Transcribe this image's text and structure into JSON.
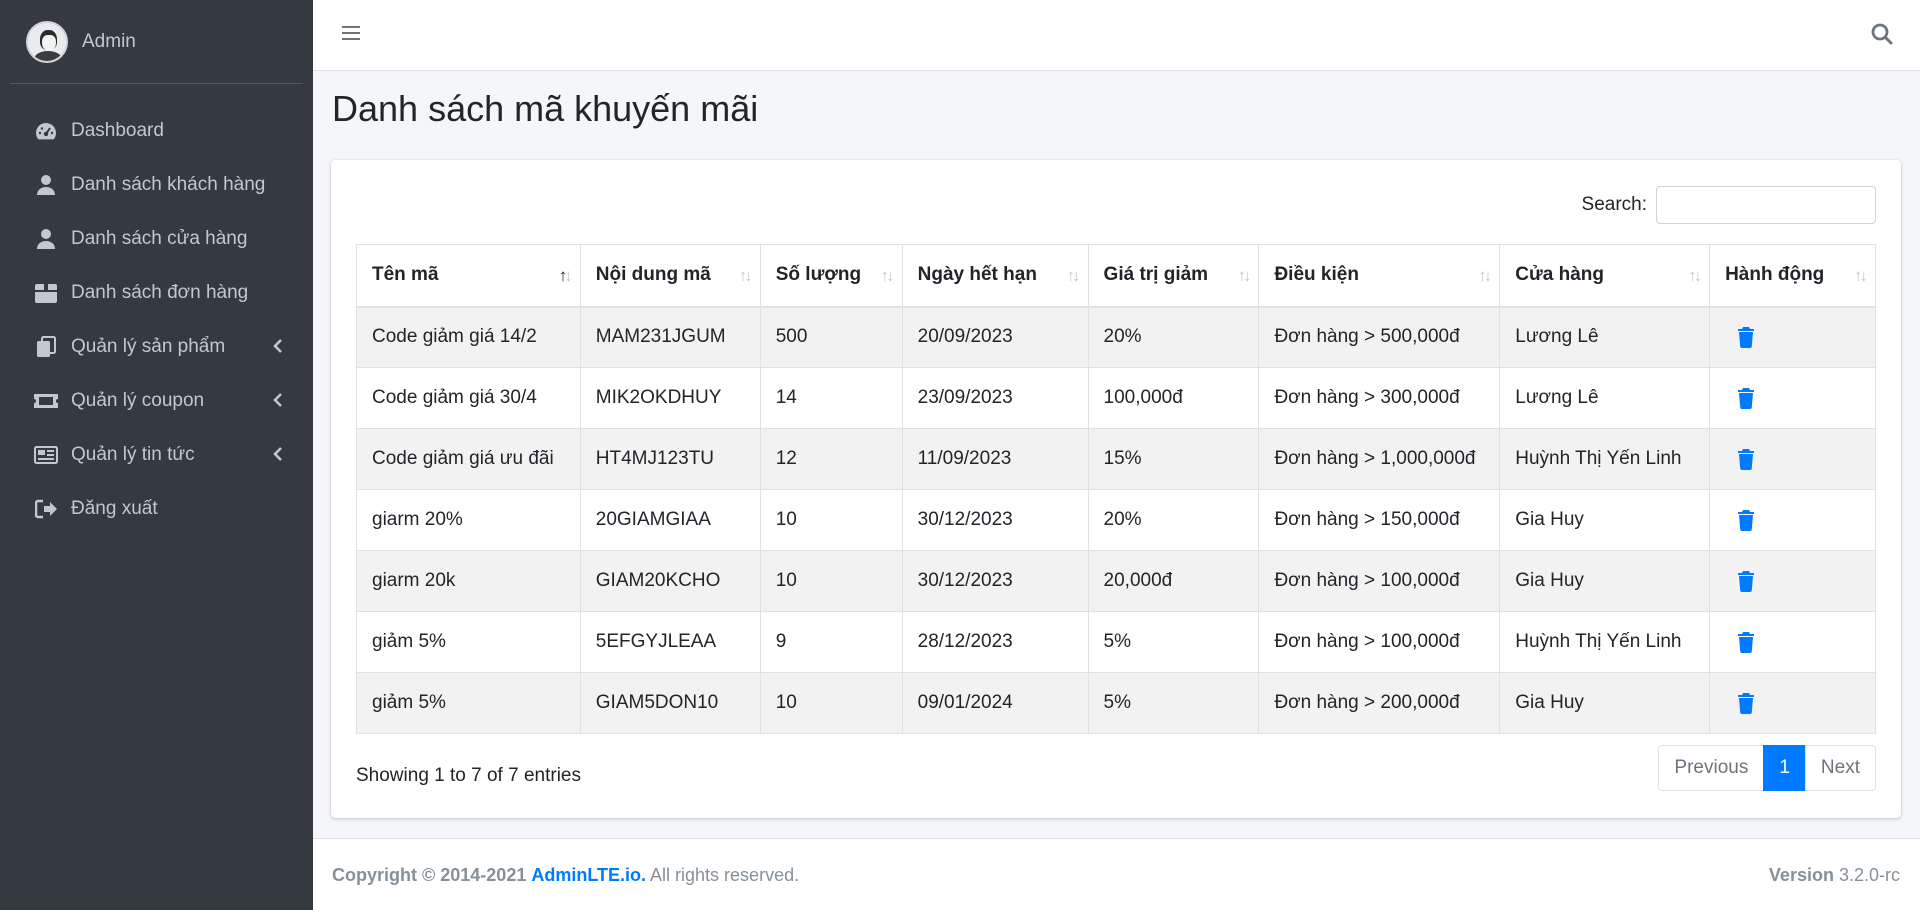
{
  "sidebar": {
    "user_name": "Admin",
    "items": [
      {
        "label": "Dashboard",
        "icon": "tachometer-icon"
      },
      {
        "label": "Danh sách khách hàng",
        "icon": "user-icon"
      },
      {
        "label": "Danh sách cửa hàng",
        "icon": "user-icon"
      },
      {
        "label": "Danh sách đơn hàng",
        "icon": "box-icon"
      },
      {
        "label": "Quản lý sản phẩm",
        "icon": "copy-icon",
        "expandable": true
      },
      {
        "label": "Quản lý coupon",
        "icon": "ticket-icon",
        "expandable": true
      },
      {
        "label": "Quản lý tin tức",
        "icon": "newspaper-icon",
        "expandable": true
      },
      {
        "label": "Đăng xuất",
        "icon": "sign-out-icon"
      }
    ]
  },
  "page": {
    "title": "Danh sách mã khuyến mãi"
  },
  "search": {
    "label": "Search:",
    "value": ""
  },
  "table": {
    "headers": [
      "Tên mã",
      "Nội dung mã",
      "Số lượng",
      "Ngày hết hạn",
      "Giá trị giảm",
      "Điều kiện",
      "Cửa hàng",
      "Hành động"
    ],
    "sorted_column": "Tên mã",
    "sort_direction": "asc",
    "rows": [
      [
        "Code giảm giá 14/2",
        "MAM231JGUM",
        "500",
        "20/09/2023",
        "20%",
        "Đơn hàng > 500,000đ",
        "Lương Lê"
      ],
      [
        "Code giảm giá 30/4",
        "MIK2OKDHUY",
        "14",
        "23/09/2023",
        "100,000đ",
        "Đơn hàng > 300,000đ",
        "Lương Lê"
      ],
      [
        "Code giảm giá ưu đãi",
        "HT4MJ123TU",
        "12",
        "11/09/2023",
        "15%",
        "Đơn hàng > 1,000,000đ",
        "Huỳnh Thị Yến Linh"
      ],
      [
        "giarm 20%",
        "20GIAMGIAA",
        "10",
        "30/12/2023",
        "20%",
        "Đơn hàng > 150,000đ",
        "Gia Huy"
      ],
      [
        "giarm 20k",
        "GIAM20KCHO",
        "10",
        "30/12/2023",
        "20,000đ",
        "Đơn hàng > 100,000đ",
        "Gia Huy"
      ],
      [
        "giảm 5%",
        "5EFGYJLEAA",
        "9",
        "28/12/2023",
        "5%",
        "Đơn hàng > 100,000đ",
        "Huỳnh Thị Yến Linh"
      ],
      [
        "giảm 5%",
        "GIAM5DON10",
        "10",
        "09/01/2024",
        "5%",
        "Đơn hàng > 200,000đ",
        "Gia Huy"
      ]
    ]
  },
  "info": "Showing 1 to 7 of 7 entries",
  "pagination": {
    "previous": "Previous",
    "current": "1",
    "next": "Next"
  },
  "footer": {
    "copyright": "Copyright © 2014-2021",
    "brand": "AdminLTE.io.",
    "rights": "All rights reserved.",
    "version_label": "Version",
    "version": "3.2.0-rc"
  },
  "colors": {
    "sidebar_bg": "#343a40",
    "primary": "#007bff",
    "body_bg": "#f4f6f9"
  }
}
